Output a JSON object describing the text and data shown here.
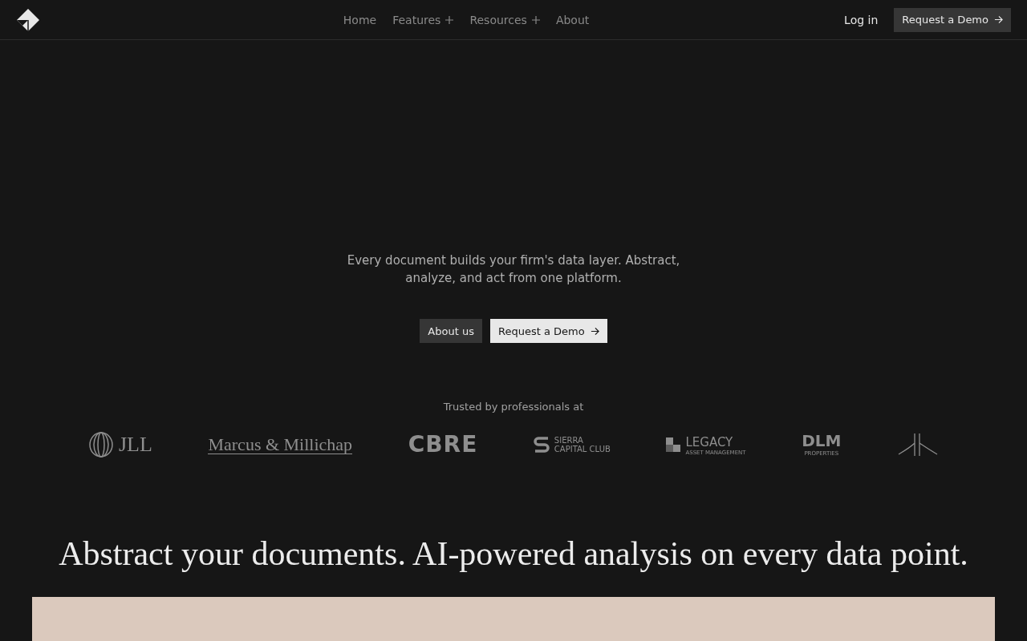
{
  "nav": {
    "links": [
      {
        "label": "Home",
        "has_menu": false
      },
      {
        "label": "Features",
        "has_menu": true
      },
      {
        "label": "Resources",
        "has_menu": true
      },
      {
        "label": "About",
        "has_menu": false
      }
    ],
    "login": "Log in",
    "cta": "Request a Demo"
  },
  "hero": {
    "tagline": "Every document builds your firm's data layer. Abstract, analyze, and act from one platform.",
    "buttons": [
      {
        "label": "About us",
        "kind": "secondary"
      },
      {
        "label": "Request a Demo",
        "kind": "primary"
      }
    ]
  },
  "trusted": {
    "title": "Trusted by professionals at",
    "logos": [
      {
        "kind": "rings",
        "text": "JLL"
      },
      {
        "kind": "serif",
        "text": "Marcus & Millichap"
      },
      {
        "kind": "heavy",
        "text": "CBRE"
      },
      {
        "kind": "stack",
        "text": "SIERRA CAPITAL CLUB"
      },
      {
        "kind": "squares",
        "text": "LEGACY",
        "sub": "ASSET MANAGEMENT"
      },
      {
        "kind": "block",
        "text": "DLM",
        "sub": "PROPERTIES"
      },
      {
        "kind": "mark"
      }
    ]
  },
  "section": {
    "heading": "Abstract your documents. AI-powered analysis on every data point."
  }
}
